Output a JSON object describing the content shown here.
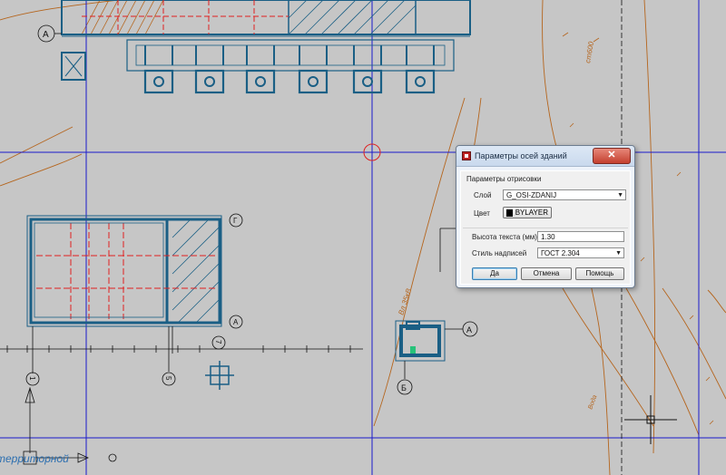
{
  "drawing": {
    "axis_labels": {
      "a_top_left": "А",
      "g_right": "Г",
      "a_mid": "А",
      "a_small": "А",
      "b_small": "Б",
      "num_1": "1",
      "num_5": "5",
      "num_7": "7"
    },
    "annotations": {
      "vl_label": "Вл 35кВ",
      "st_label": "ст600",
      "road_label": "Вода",
      "bottom_italic": "территорной"
    },
    "colors": {
      "background": "#c6c6c6",
      "building": "#1a5f85",
      "axis_line": "#1b1bcc",
      "contour": "#b5651d",
      "red_dash": "#e02020"
    }
  },
  "dialog": {
    "title": "Параметры осей зданий",
    "close_symbol": "✕",
    "group_title": "Параметры отрисовки",
    "layer_label": "Слой",
    "layer_value": "G_OSI-ZDANIJ",
    "color_label": "Цвет",
    "color_value": "BYLAYER",
    "text_height_label": "Высота текста (мм)",
    "text_height_value": "1.30",
    "text_style_label": "Стиль надписей",
    "text_style_value": "ГОСТ 2.304",
    "ok_label": "Да",
    "cancel_label": "Отмена",
    "help_label": "Помощь"
  }
}
